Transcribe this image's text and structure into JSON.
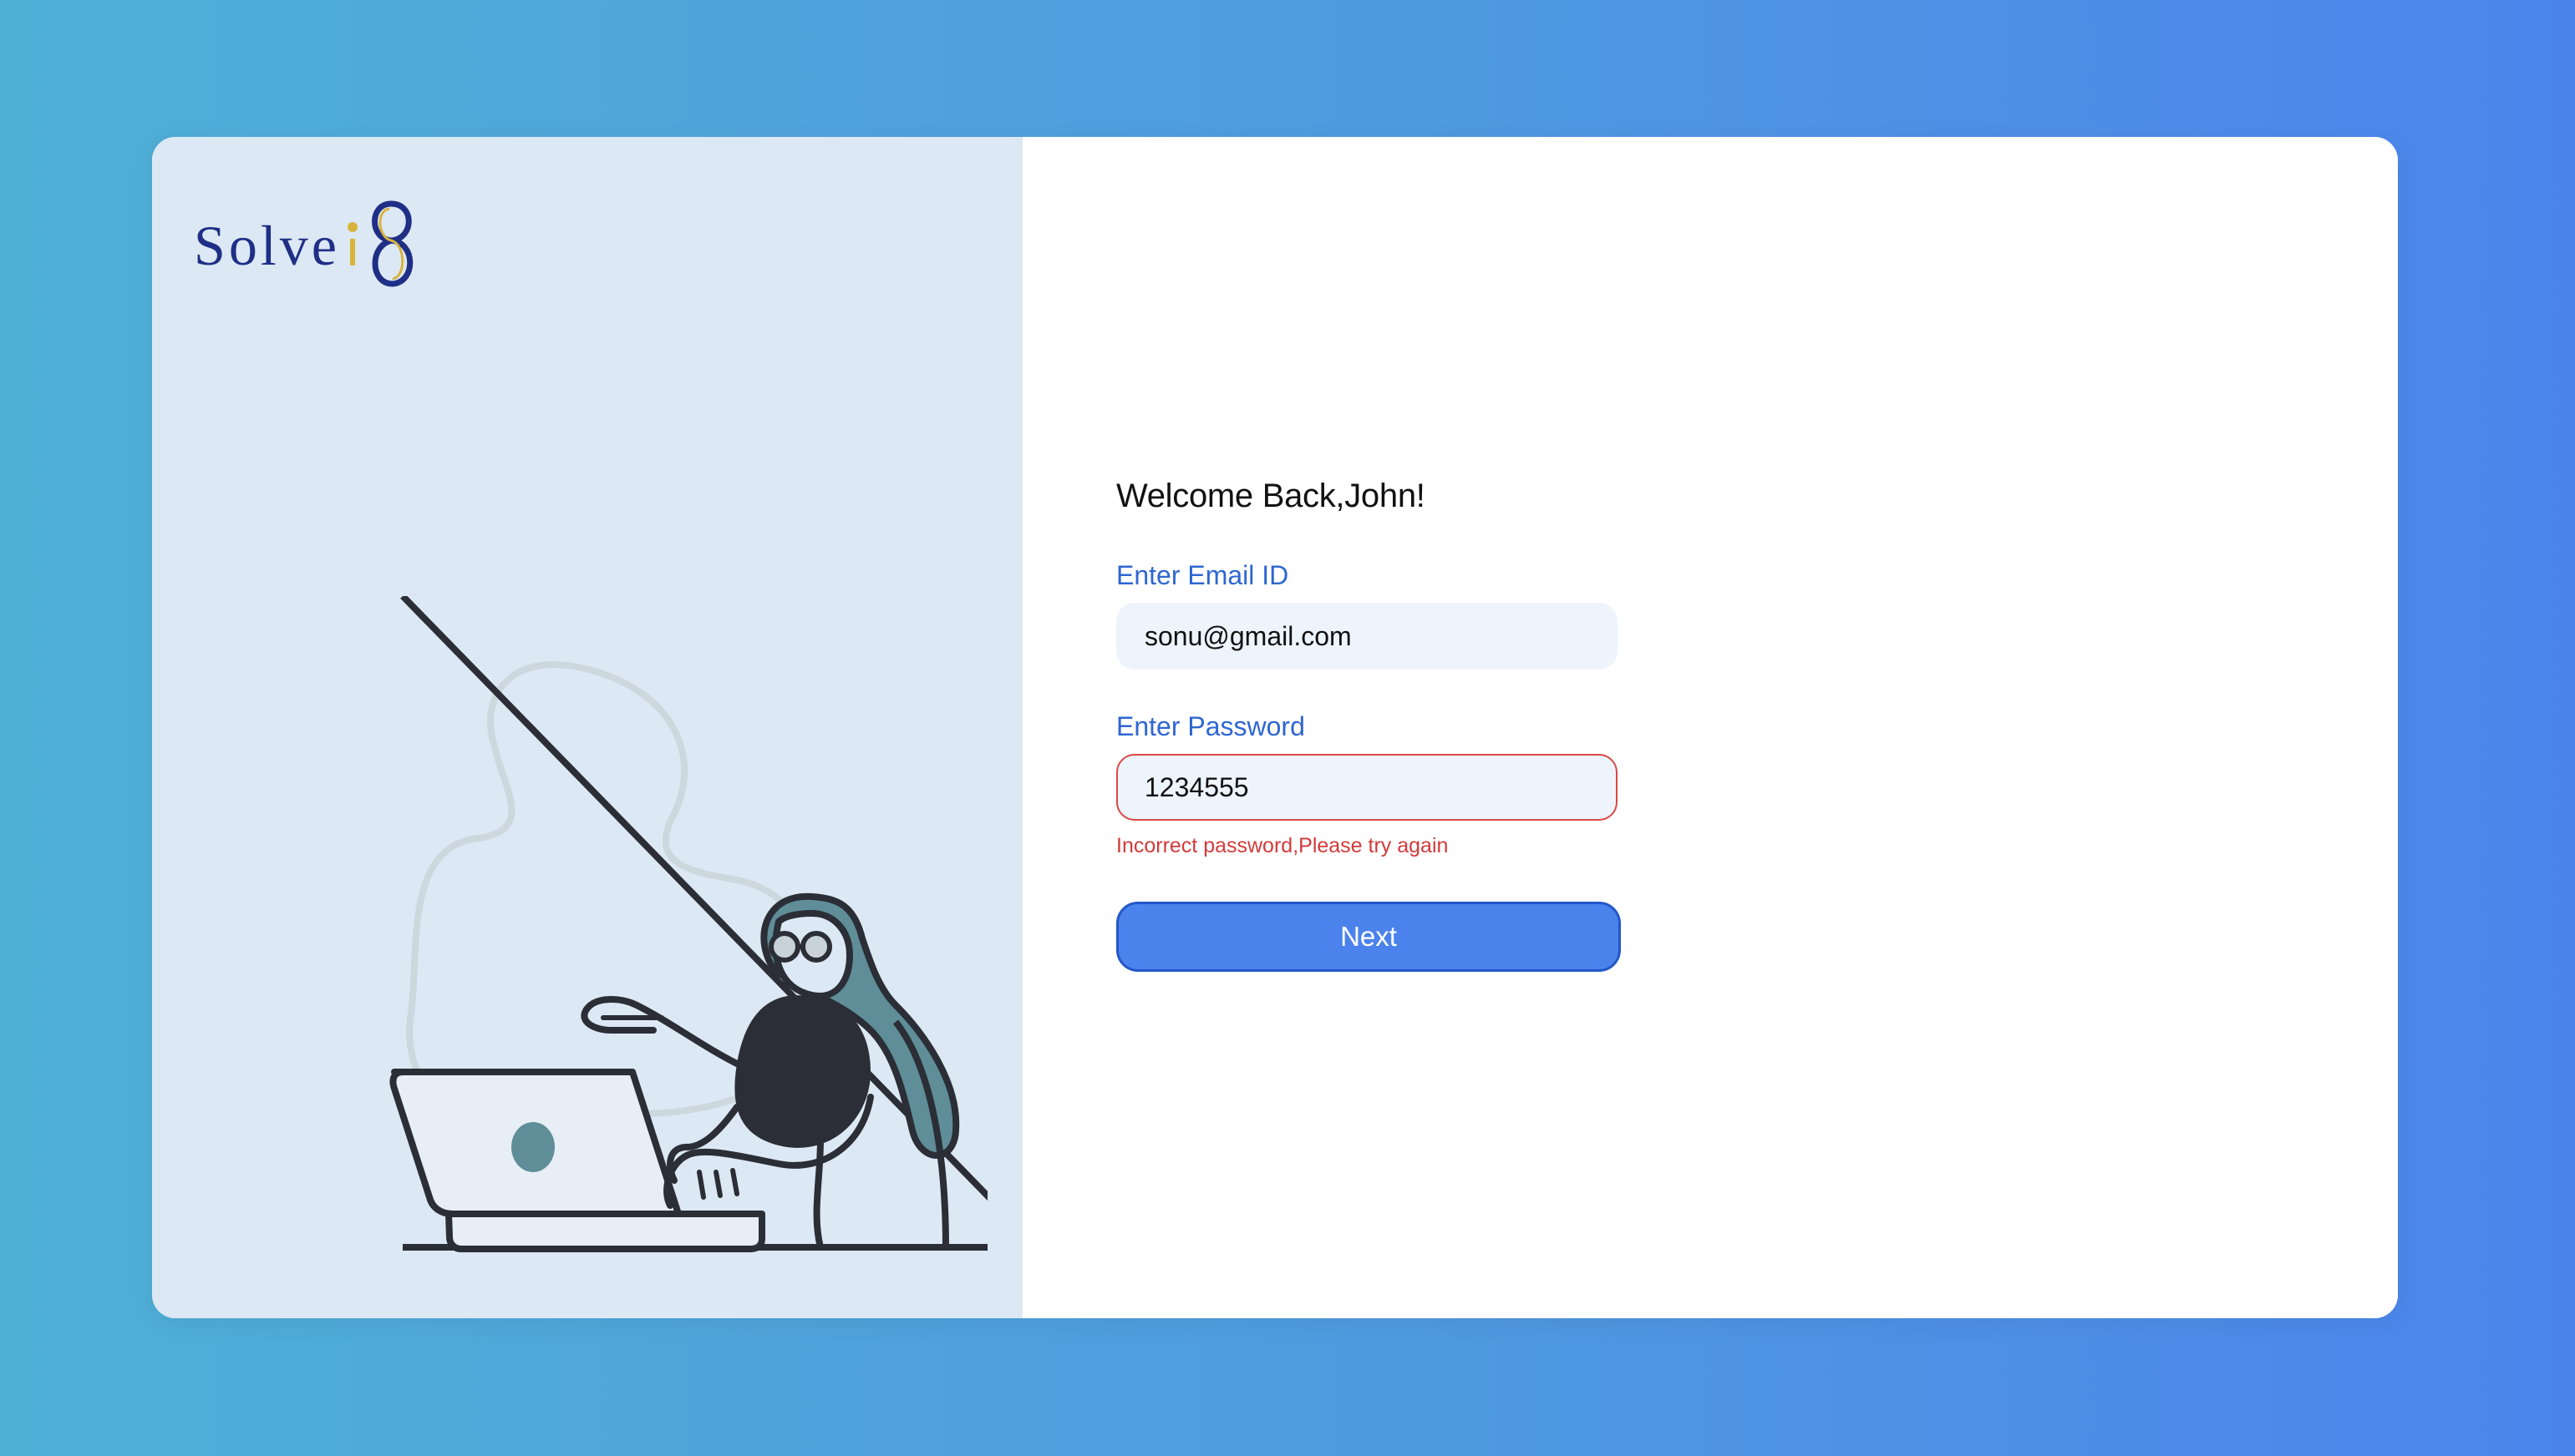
{
  "brand": {
    "logo_text": "Solvei8",
    "colors": {
      "logo_navy": "#1f2f86",
      "logo_gold": "#d8b33d",
      "accent": "#4b82ec",
      "label_blue": "#2f66d2",
      "error_red": "#d23a3a",
      "left_panel_bg": "#dce8f4"
    }
  },
  "login": {
    "welcome": "Welcome Back,John!",
    "email_label": "Enter Email ID",
    "email_value": "sonu@gmail.com",
    "password_label": "Enter Password",
    "password_value": "1234555",
    "error_message": "Incorrect password,Please try again",
    "next_label": "Next"
  },
  "illustration": {
    "icon": "person-at-laptop-illustration"
  }
}
